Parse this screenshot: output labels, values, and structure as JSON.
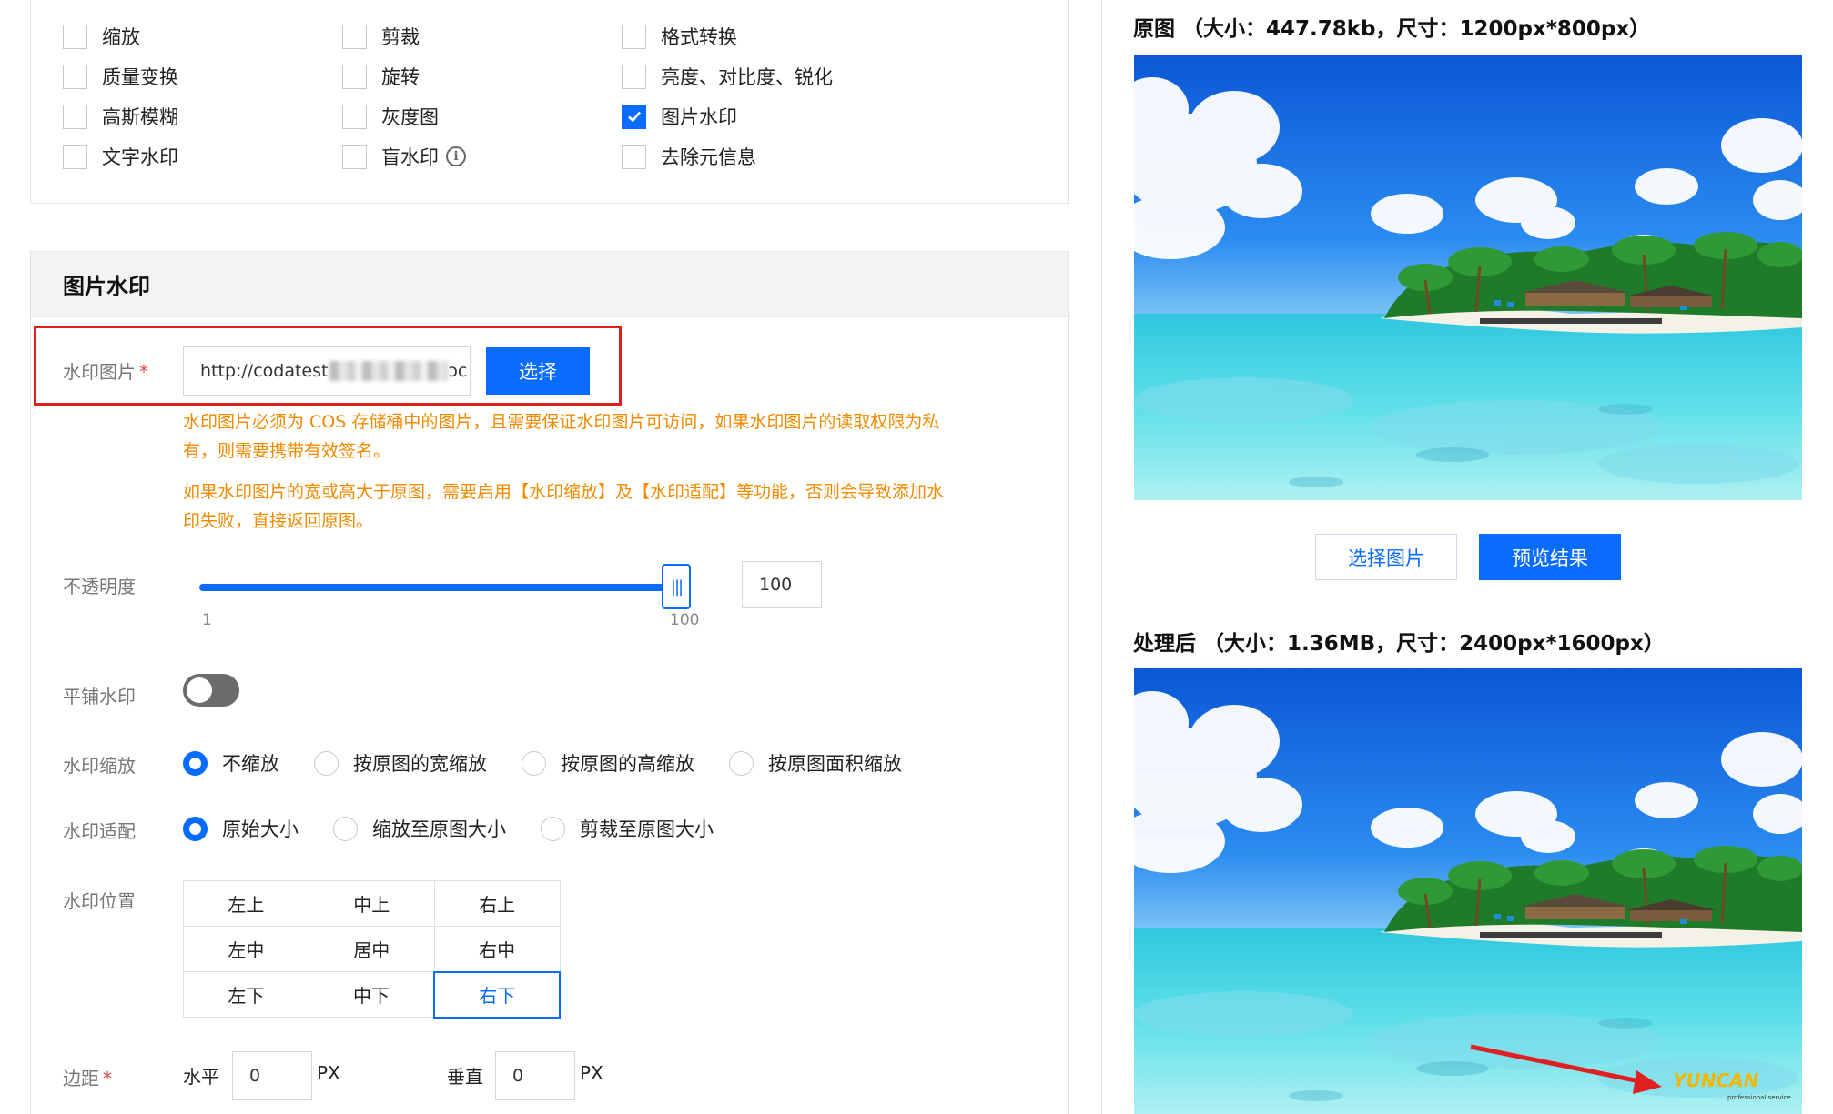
{
  "operations": [
    [
      {
        "label": "缩放",
        "checked": false
      },
      {
        "label": "剪裁",
        "checked": false
      },
      {
        "label": "格式转换",
        "checked": false
      }
    ],
    [
      {
        "label": "质量变换",
        "checked": false
      },
      {
        "label": "旋转",
        "checked": false
      },
      {
        "label": "亮度、对比度、锐化",
        "checked": false
      }
    ],
    [
      {
        "label": "高斯模糊",
        "checked": false
      },
      {
        "label": "灰度图",
        "checked": false
      },
      {
        "label": "图片水印",
        "checked": true
      }
    ],
    [
      {
        "label": "文字水印",
        "checked": false
      },
      {
        "label": "盲水印",
        "checked": false,
        "info": "i"
      },
      {
        "label": "去除元信息",
        "checked": false
      }
    ]
  ],
  "section": {
    "title": "图片水印",
    "image_label": "水印图片",
    "required_mark": "*",
    "url_prefix": "http://codatest",
    "url_suffix": "ɔc",
    "select_button": "选择",
    "warning_1a": "水印图片必须为 COS 存储桶中的图片，且需要保证水印图片可访问，如果水印图片的读取权限为私",
    "warning_1b": "有，则需要携带有效签名。",
    "warning_2a": "如果水印图片的宽或高大于原图，需要启用【水印缩放】及【水印适配】等功能，否则会导致添加水",
    "warning_2b": "印失败，直接返回原图。",
    "opacity_label": "不透明度",
    "opacity_value": "100",
    "opacity_percent": 100,
    "opacity_min": "1",
    "opacity_max": "100",
    "tile_label": "平铺水印",
    "tile_on": false,
    "scale_label": "水印缩放",
    "scale_options": [
      "不缩放",
      "按原图的宽缩放",
      "按原图的高缩放",
      "按原图面积缩放"
    ],
    "scale_selected": 0,
    "fit_label": "水印适配",
    "fit_options": [
      "原始大小",
      "缩放至原图大小",
      "剪裁至原图大小"
    ],
    "fit_selected": 0,
    "position_label": "水印位置",
    "positions": [
      [
        "左上",
        "中上",
        "右上"
      ],
      [
        "左中",
        "居中",
        "右中"
      ],
      [
        "左下",
        "中下",
        "右下"
      ]
    ],
    "position_selected": "右下",
    "margin_label": "边距",
    "horizontal_label": "水平",
    "horizontal_value": "0",
    "vertical_label": "垂直",
    "vertical_value": "0",
    "unit": "PX"
  },
  "preview": {
    "original_title": "原图 （大小：447.78kb，尺寸：1200px*800px）",
    "processed_title": "处理后 （大小：1.36MB，尺寸：2400px*1600px）",
    "select_image_button": "选择图片",
    "preview_button": "预览结果",
    "watermark_text": "YUNCAN",
    "watermark_subtext": "professional service"
  },
  "colors": {
    "primary": "#0a6cff",
    "warning": "#f08a00",
    "highlight": "#e02020",
    "arrow": "#e02020"
  }
}
